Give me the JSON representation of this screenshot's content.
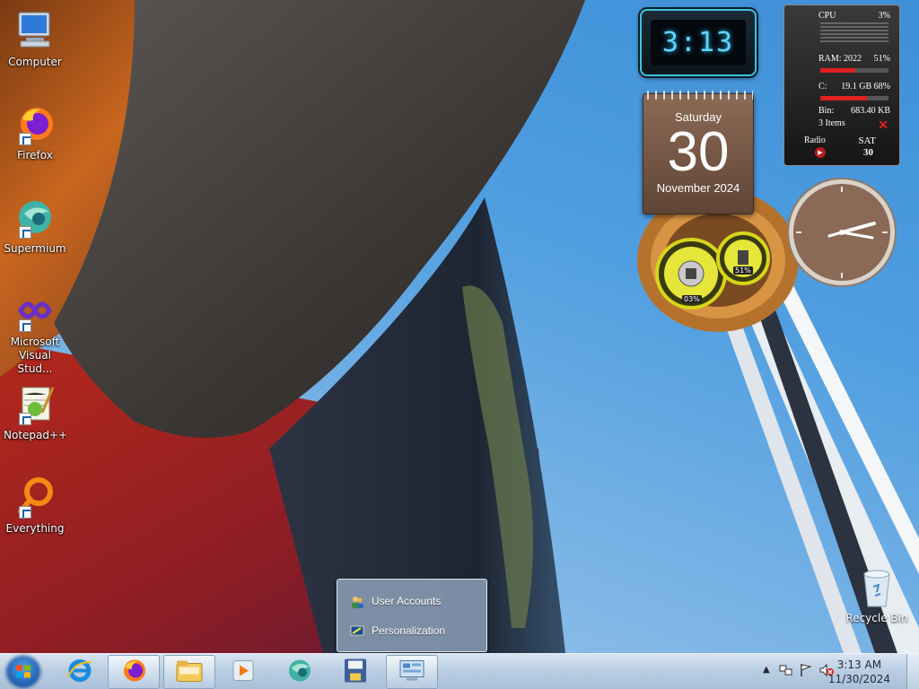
{
  "desktop": {
    "icons": [
      {
        "label": "Computer",
        "icon": "computer-icon"
      },
      {
        "label": "Firefox",
        "icon": "firefox-icon"
      },
      {
        "label": "Supermium",
        "icon": "supermium-icon"
      },
      {
        "label": "Microsoft Visual Stud...",
        "icon": "visual-studio-icon"
      },
      {
        "label": "Notepad++",
        "icon": "notepadpp-icon"
      },
      {
        "label": "Everything",
        "icon": "everything-icon"
      }
    ],
    "recycle_bin": {
      "label": "Recycle Bin",
      "icon": "recycle-bin-icon"
    }
  },
  "gadgets": {
    "digital_clock": {
      "time": "3:13"
    },
    "calendar": {
      "weekday": "Saturday",
      "day": "30",
      "month_year": "November 2024"
    },
    "system_meter": {
      "cpu_label": "CPU",
      "cpu_value": "3%",
      "cpu_fraction": 0.03,
      "ram_label": "RAM: 2022",
      "ram_value": "51%",
      "ram_fraction": 0.51,
      "disk_label": "C:",
      "disk_value": "19.1 GB 68%",
      "disk_fraction": 0.68,
      "bin_label": "Bin:",
      "bin_value": "683.40 KB",
      "bin_items": "3 Items",
      "radio_label": "Radio",
      "day_abbr": "SAT",
      "day_num": "30"
    },
    "gauges": {
      "cpu_gauge": "03%",
      "ram_gauge": "51%"
    }
  },
  "jump_list": {
    "items": [
      {
        "label": "User Accounts",
        "icon": "user-accounts-icon"
      },
      {
        "label": "Personalization",
        "icon": "personalization-icon"
      }
    ]
  },
  "taskbar": {
    "pinned": [
      {
        "name": "internet-explorer",
        "icon": "ie-icon"
      },
      {
        "name": "firefox",
        "icon": "firefox-icon"
      },
      {
        "name": "file-explorer",
        "icon": "folder-icon"
      },
      {
        "name": "media-player",
        "icon": "media-player-icon"
      },
      {
        "name": "supermium",
        "icon": "supermium-icon"
      },
      {
        "name": "save-app",
        "icon": "floppy-icon"
      },
      {
        "name": "control-panel",
        "icon": "control-panel-icon"
      }
    ],
    "tray": {
      "time": "3:13 AM",
      "date": "11/30/2024"
    }
  },
  "colors": {
    "accent": "#3cc3e0",
    "taskbar": "#b9cde2",
    "sky": "#4f9ee0"
  }
}
